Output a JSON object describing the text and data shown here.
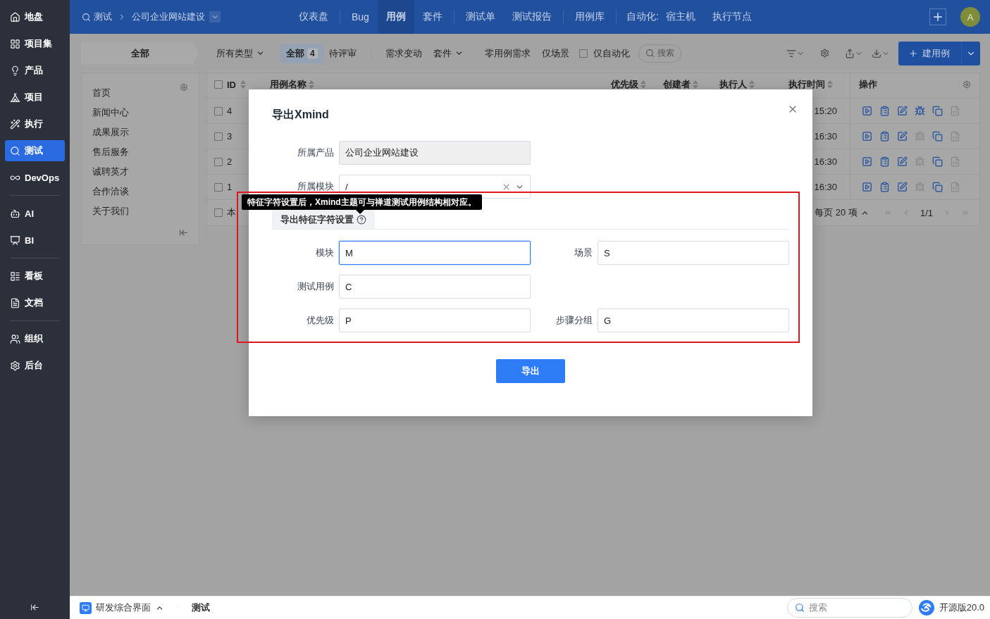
{
  "sidebar": {
    "groups": [
      [
        {
          "label": "地盘",
          "selected": false
        },
        {
          "label": "项目集",
          "selected": false
        },
        {
          "label": "产品",
          "selected": false
        },
        {
          "label": "项目",
          "selected": false
        },
        {
          "label": "执行",
          "selected": false
        },
        {
          "label": "测试",
          "selected": true
        },
        {
          "label": "DevOps",
          "selected": false
        }
      ],
      [
        {
          "label": "AI",
          "selected": false
        },
        {
          "label": "BI",
          "selected": false
        }
      ],
      [
        {
          "label": "看板",
          "selected": false
        },
        {
          "label": "文档",
          "selected": false
        }
      ],
      [
        {
          "label": "组织",
          "selected": false
        },
        {
          "label": "后台",
          "selected": false
        }
      ]
    ]
  },
  "topbar": {
    "breadcrumb": {
      "section": "测试",
      "product": "公司企业网站建设"
    },
    "nav_groups": [
      {
        "items": [
          {
            "label": "仪表盘",
            "selected": false
          }
        ]
      },
      {
        "items": [
          {
            "label": "Bug",
            "selected": false
          },
          {
            "label": "用例",
            "selected": true
          },
          {
            "label": "套件",
            "selected": false
          }
        ]
      },
      {
        "items": [
          {
            "label": "测试单",
            "selected": false
          },
          {
            "label": "测试报告",
            "selected": false
          }
        ]
      },
      {
        "items": [
          {
            "label": "用例库",
            "selected": false
          }
        ]
      },
      {
        "label": "自动化:",
        "items": [
          {
            "label": "宿主机",
            "selected": false
          },
          {
            "label": "执行节点",
            "selected": false
          }
        ]
      }
    ],
    "avatar": "A"
  },
  "toolbar": {
    "module_tab": "全部",
    "filters": [
      {
        "kind": "dropdown",
        "label": "所有类型"
      },
      {
        "kind": "tab",
        "label": "全部",
        "count": "4",
        "selected": true
      },
      {
        "kind": "tab",
        "label": "待评审",
        "selected": false
      },
      {
        "kind": "separator"
      },
      {
        "kind": "tab",
        "label": "需求变动",
        "selected": false
      },
      {
        "kind": "dropdown",
        "label": "套件"
      },
      {
        "kind": "tab",
        "label": "零用例需求",
        "selected": false
      },
      {
        "kind": "tab",
        "label": "仅场景",
        "selected": false
      },
      {
        "kind": "checkbox",
        "label": "仅自动化",
        "checked": false
      }
    ],
    "search_placeholder": "搜索",
    "create_button": "建用例"
  },
  "module_tree": {
    "items": [
      "首页",
      "新闻中心",
      "成果展示",
      "售后服务",
      "诚聘英才",
      "合作洽谈",
      "关于我们"
    ]
  },
  "table": {
    "select_all_checked": false,
    "columns": [
      {
        "label": "ID",
        "sortable": true
      },
      {
        "label": "用例名称",
        "sortable": true
      },
      {
        "label": "优先级",
        "sortable": true
      },
      {
        "label": "创建者",
        "sortable": true
      },
      {
        "label": "执行人",
        "sortable": true
      },
      {
        "label": "执行时间",
        "sortable": true
      },
      {
        "label": "操作",
        "sortable": false
      }
    ],
    "rows": [
      {
        "id": "4",
        "checked": false,
        "time": "15:20",
        "bug_enabled": true
      },
      {
        "id": "3",
        "checked": false,
        "time": "16:30",
        "bug_enabled": false
      },
      {
        "id": "2",
        "checked": false,
        "time": "16:30",
        "bug_enabled": false
      },
      {
        "id": "1",
        "checked": false,
        "time": "16:30",
        "bug_enabled": false
      }
    ],
    "footer": {
      "select_page_checked": false,
      "select_label": "本",
      "page_size": "每页 20 项",
      "page": "1/1"
    }
  },
  "modal": {
    "title": "导出Xmind",
    "fields": [
      {
        "kind": "text",
        "label": "所属产品",
        "value": "公司企业网站建设",
        "disabled": true
      },
      {
        "kind": "select",
        "label": "所属模块",
        "value": "/"
      }
    ],
    "section": {
      "title": "导出特征字符设置",
      "tooltip": "特征字符设置后，Xmind主题可与禅道测试用例结构相对应。"
    },
    "char_rows": [
      [
        {
          "label": "模块",
          "value": "M",
          "focused": true
        },
        {
          "label": "场景",
          "value": "S",
          "focused": false
        }
      ],
      [
        {
          "label": "测试用例",
          "value": "C",
          "focused": false
        }
      ],
      [
        {
          "label": "优先级",
          "value": "P",
          "focused": false
        },
        {
          "label": "步骤分组",
          "value": "G",
          "focused": false
        }
      ]
    ],
    "submit": "导出"
  },
  "statusbar": {
    "app": "研发综合界面",
    "crumb": "测试",
    "search_placeholder": "搜索",
    "version": "开源版20.0"
  }
}
